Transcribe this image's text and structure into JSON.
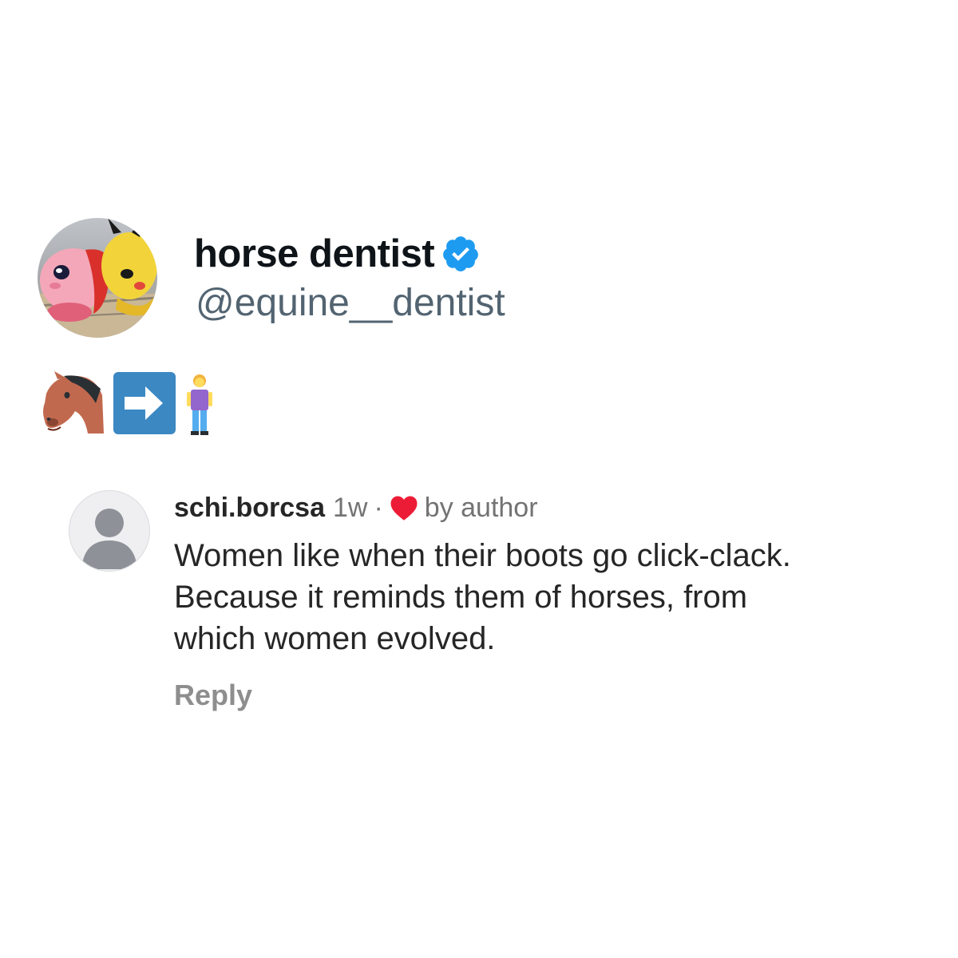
{
  "tweet": {
    "display_name": "horse dentist",
    "handle": "@equine__dentist",
    "verified": true,
    "verified_icon": "verified-badge-icon",
    "brand_color": "#1d9bf0",
    "emojis": [
      "horse-face-emoji",
      "right-arrow-button-emoji",
      "woman-standing-emoji"
    ]
  },
  "comment": {
    "username": "schi.borcsa",
    "time": "1w",
    "separator": "·",
    "liked_icon": "heart-icon",
    "liked_label": "by author",
    "heart_color": "#ed1c36",
    "lines": [
      "Women like when their boots go click-clack.",
      "Because it reminds them of horses, from",
      "which women evolved."
    ],
    "reply_label": "Reply"
  }
}
